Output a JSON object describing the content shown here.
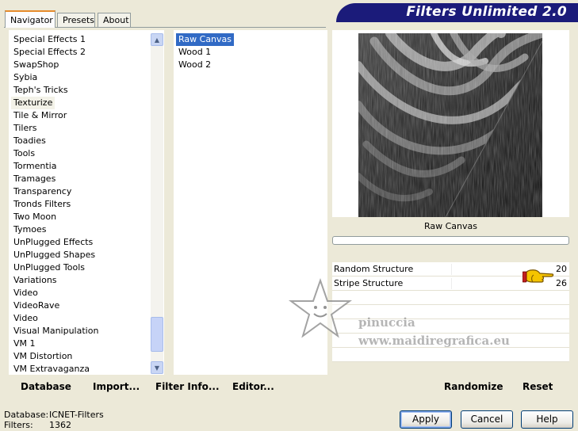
{
  "app": {
    "title": "Filters Unlimited 2.0"
  },
  "tabs": [
    {
      "label": "Navigator",
      "active": true
    },
    {
      "label": "Presets",
      "active": false
    },
    {
      "label": "About",
      "active": false
    }
  ],
  "categories": {
    "items": [
      "Special Effects 1",
      "Special Effects 2",
      "SwapShop",
      "Sybia",
      "Teph's Tricks",
      "Texturize",
      "Tile & Mirror",
      "Tilers",
      "Toadies",
      "Tools",
      "Tormentia",
      "Tramages",
      "Transparency",
      "Tronds Filters",
      "Two Moon",
      "Tymoes",
      "UnPlugged Effects",
      "UnPlugged Shapes",
      "UnPlugged Tools",
      "Variations",
      "Video",
      "VideoRave",
      "Video",
      "Visual Manipulation",
      "VM 1",
      "VM Distortion",
      "VM Extravaganza"
    ],
    "selected": "Texturize"
  },
  "filters": {
    "items": [
      "Raw Canvas",
      "Wood 1",
      "Wood 2"
    ],
    "selected": "Raw Canvas"
  },
  "preview": {
    "filter_name": "Raw Canvas"
  },
  "params": [
    {
      "label": "Random Structure",
      "value": "20"
    },
    {
      "label": "Stripe Structure",
      "value": "26"
    }
  ],
  "left_bar": {
    "database": "Database",
    "import": "Import...",
    "filter_info": "Filter Info...",
    "editor": "Editor..."
  },
  "right_bar": {
    "randomize": "Randomize",
    "reset": "Reset"
  },
  "status": {
    "database_label": "Database:",
    "database_value": "ICNET-Filters",
    "filters_label": "Filters:",
    "filters_value": "1362"
  },
  "buttons": {
    "apply": "Apply",
    "cancel": "Cancel",
    "help": "Help"
  },
  "watermark": {
    "line1": "pinuccia",
    "line2": "www.maidiregrafica.eu"
  },
  "colors": {
    "banner": "#1B1B7A",
    "selection": "#316AC5",
    "tab_accent": "#E68B2C"
  }
}
